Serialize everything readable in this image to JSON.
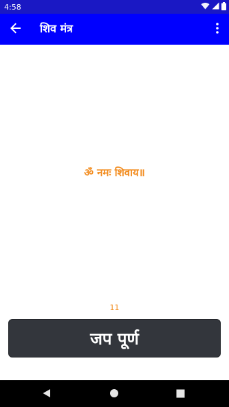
{
  "status_bar": {
    "time": "4:58",
    "icons": [
      "wifi-icon",
      "signal-icon",
      "battery-icon"
    ]
  },
  "app_bar": {
    "title": "शिव मंत्र",
    "back_icon": "arrow-left-icon",
    "menu_icon": "more-vertical-icon"
  },
  "main": {
    "mantra": "ॐ नमः शिवाय॥",
    "count": "11",
    "complete_button_label": "जप पूर्ण"
  },
  "nav_bar": {
    "buttons": [
      "back-triangle-icon",
      "home-circle-icon",
      "recents-square-icon"
    ]
  },
  "colors": {
    "status_bar": "#1a18c4",
    "app_bar": "#0000ff",
    "accent_text": "#f28c1f",
    "button_bg": "#33363c",
    "nav_bar": "#000000"
  }
}
